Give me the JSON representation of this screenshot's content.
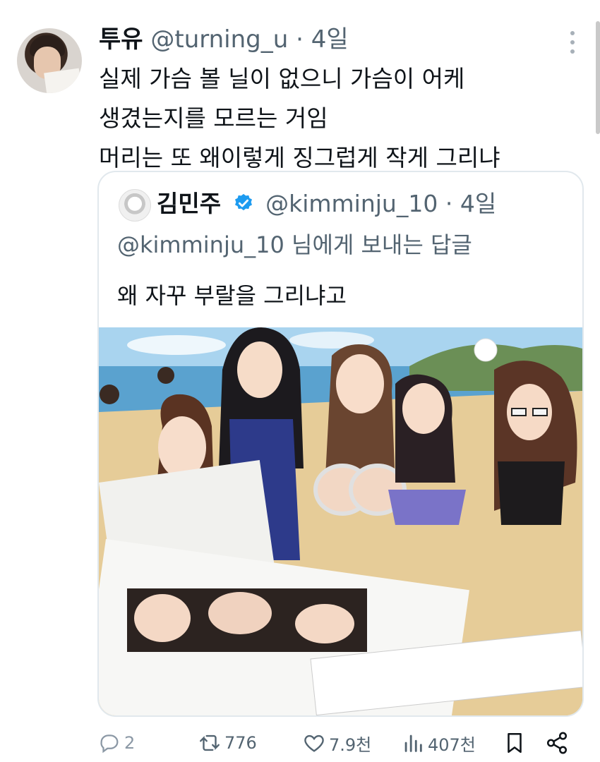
{
  "tweet": {
    "author_name": "투유",
    "author_handle": "@turning_u",
    "separator": "·",
    "time": "4일",
    "text_lines": [
      "실제 가슴 볼 닐이 없으니 가슴이 어케",
      "생겼는지를 모르는 거임",
      "머리는 또 왜이렇게 징그럽게 작게 그리냐"
    ]
  },
  "quote": {
    "author_name": "김민주",
    "author_handle": "@kimminju_10",
    "separator": "·",
    "time": "4일",
    "reply_to": "@kimminju_10 님에게 보내는 답글",
    "text": "왜 자꾸 부랄을 그리냐고",
    "verified_color": "#1d9bf0"
  },
  "actions": {
    "reply_count": "2",
    "retweet_count": "776",
    "like_count": "7.9천",
    "views_count": "407천"
  },
  "icons": {
    "reply": "reply-icon",
    "retweet": "retweet-icon",
    "like": "heart-icon",
    "views": "views-icon",
    "bookmark": "bookmark-icon",
    "share": "share-icon",
    "more": "more-vertical-icon"
  }
}
